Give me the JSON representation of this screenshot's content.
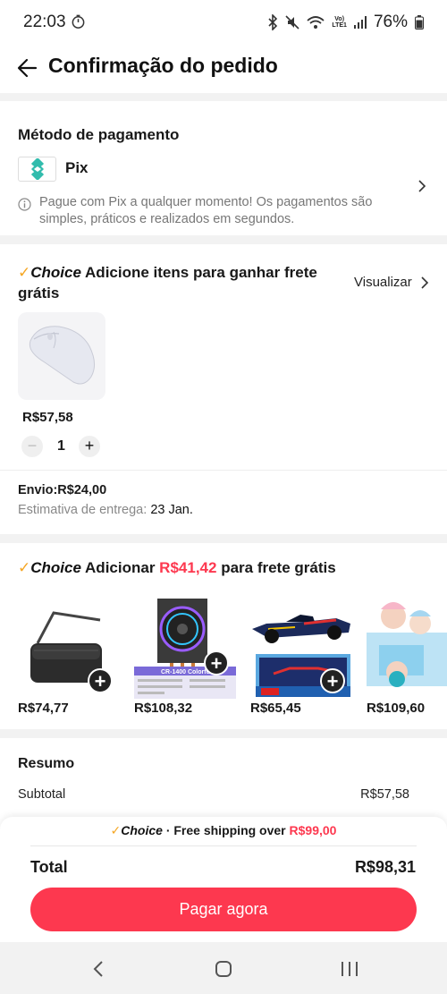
{
  "status_bar": {
    "time": "22:03",
    "battery": "76%",
    "network": "LTE1"
  },
  "header": {
    "title": "Confirmação do pedido"
  },
  "payment": {
    "title": "Método de pagamento",
    "method": "Pix",
    "description": "Pague com Pix a qualquer momento! Os pagamentos são simples, práticos e realizados em segundos."
  },
  "choice_badge": "Choice",
  "section1": {
    "title": "Adicione itens para ganhar frete grátis",
    "view_all": "Visualizar",
    "product_price": "R$57,58",
    "quantity": "1",
    "shipping_label": "Envio:R$24,00",
    "estimate_label": "Estimativa de entrega:",
    "estimate_date": "23 Jan."
  },
  "section2": {
    "title_prefix": "Adicionar",
    "title_amount": "R$41,42",
    "title_suffix": "para frete grátis",
    "items": [
      {
        "price": "R$74,77",
        "icon": "crossbody-bag"
      },
      {
        "price": "R$108,32",
        "icon": "cpu-cooler"
      },
      {
        "price": "R$65,45",
        "icon": "f1-car-model"
      },
      {
        "price": "R$109,60",
        "icon": "figure-toys"
      }
    ],
    "cooler_box_label": "CR-1400 Colorful"
  },
  "summary": {
    "title": "Resumo",
    "subtotal_label": "Subtotal",
    "subtotal_value": "R$57,58"
  },
  "footer": {
    "free_ship_text": "· Free shipping over",
    "free_ship_amount": "R$99,00",
    "total_label": "Total",
    "total_value": "R$98,31",
    "pay_button": "Pagar agora"
  },
  "colors": {
    "accent": "#fd384f",
    "choice_check": "#f5a623",
    "pix": "#32bcad"
  }
}
